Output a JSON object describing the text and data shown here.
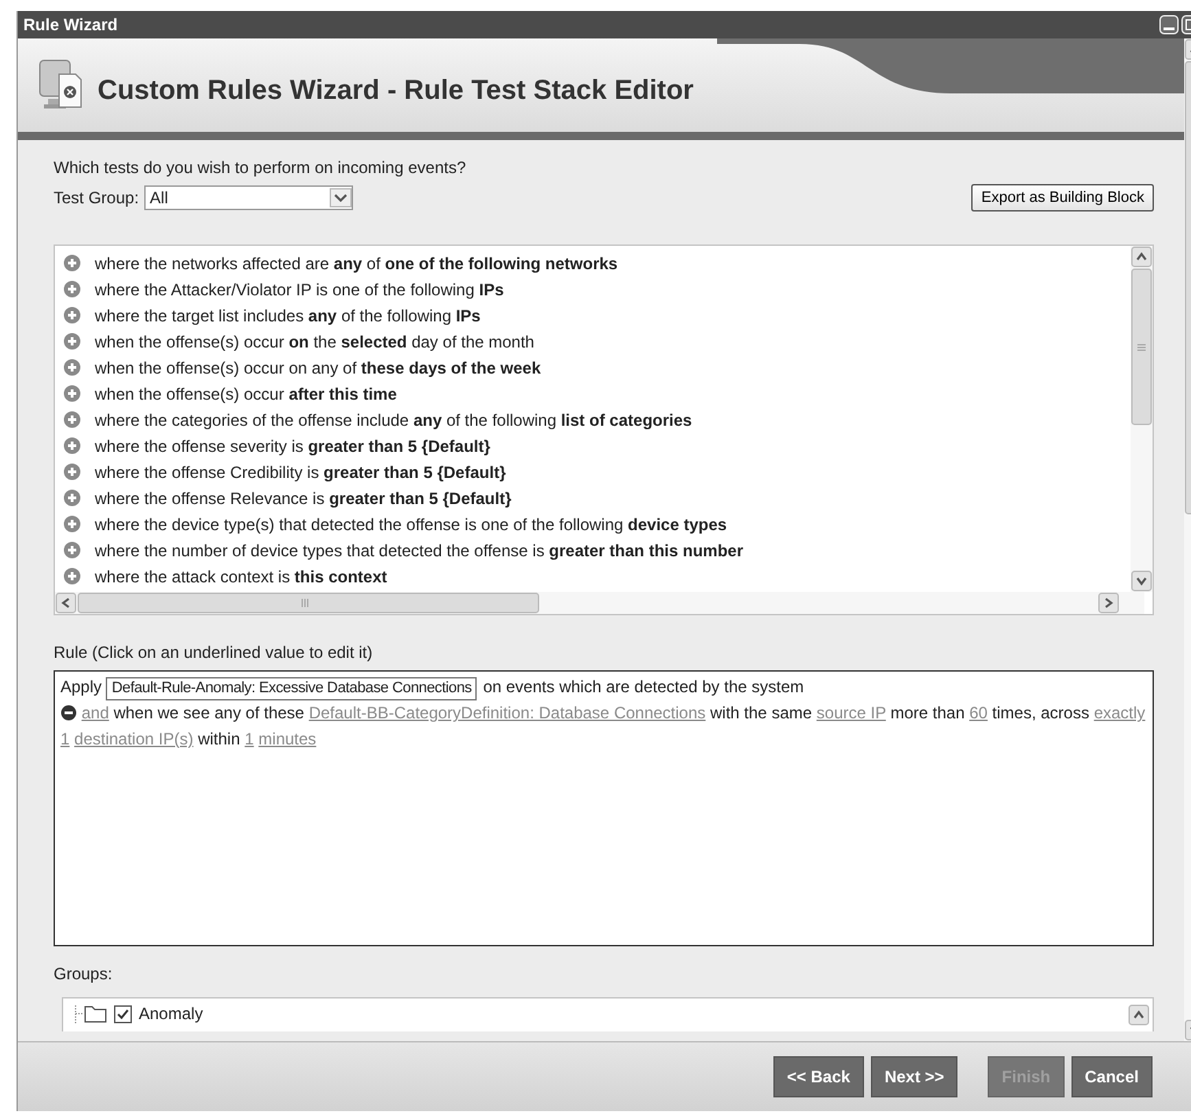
{
  "window": {
    "title": "Rule Wizard"
  },
  "header": {
    "title": "Custom Rules Wizard - Rule Test Stack Editor"
  },
  "question": "Which tests do you wish to perform on incoming events?",
  "test_group": {
    "label": "Test Group:",
    "value": "All"
  },
  "export_button": "Export as Building Block",
  "tests": [
    "where the networks affected are **any** of **one of the following networks**",
    "where the Attacker/Violator IP is one of the following **IPs**",
    "where the target list includes **any** of the following **IPs**",
    "when the offense(s) occur **on** the **selected** day of the month",
    "when the offense(s) occur on any of **these days of the week**",
    "when the offense(s) occur **after this time**",
    "where the categories of the offense include **any** of the following **list of categories**",
    "where the offense severity is **greater than 5 {Default}**",
    "where the offense Credibility is **greater than 5 {Default}**",
    "where the offense Relevance is **greater than 5 {Default}**",
    "where the device type(s) that detected the offense is one of the following **device types**",
    "where the number of device types that detected the offense is **greater than this number**",
    "where the attack context is **this context**"
  ],
  "rule": {
    "label": "Rule (Click on an underlined value to edit it)",
    "lines": [
      {
        "kind": "header",
        "segments": [
          {
            "kind": "text",
            "text": "Apply"
          },
          {
            "kind": "field",
            "text": "Default-Rule-Anomaly: Excessive Database Connections"
          },
          {
            "kind": "text",
            "text": "on events which are detected by the system"
          }
        ]
      },
      {
        "kind": "condition",
        "segments": [
          {
            "kind": "link",
            "text": "and"
          },
          {
            "kind": "text",
            "text": "when we see any of these"
          },
          {
            "kind": "link",
            "text": "Default-BB-CategoryDefinition: Database Connections"
          },
          {
            "kind": "text",
            "text": "with the same"
          },
          {
            "kind": "link",
            "text": "source IP"
          },
          {
            "kind": "text",
            "text": "more than"
          },
          {
            "kind": "link",
            "text": "60"
          },
          {
            "kind": "text",
            "text": "times, across"
          },
          {
            "kind": "link",
            "text": "exactly"
          },
          {
            "kind": "link",
            "text": "1"
          },
          {
            "kind": "link",
            "text": "destination IP(s)"
          },
          {
            "kind": "text",
            "text": "within"
          },
          {
            "kind": "link",
            "text": "1"
          },
          {
            "kind": "link",
            "text": "minutes"
          }
        ]
      }
    ]
  },
  "groups": {
    "label": "Groups:",
    "items": [
      {
        "label": "Anomaly",
        "checked": true
      }
    ]
  },
  "buttons": [
    {
      "label": "<< Back",
      "disabled": false
    },
    {
      "label": "Next >>",
      "disabled": false
    },
    {
      "label": "Finish",
      "disabled": true
    },
    {
      "label": "Cancel",
      "disabled": false
    }
  ]
}
